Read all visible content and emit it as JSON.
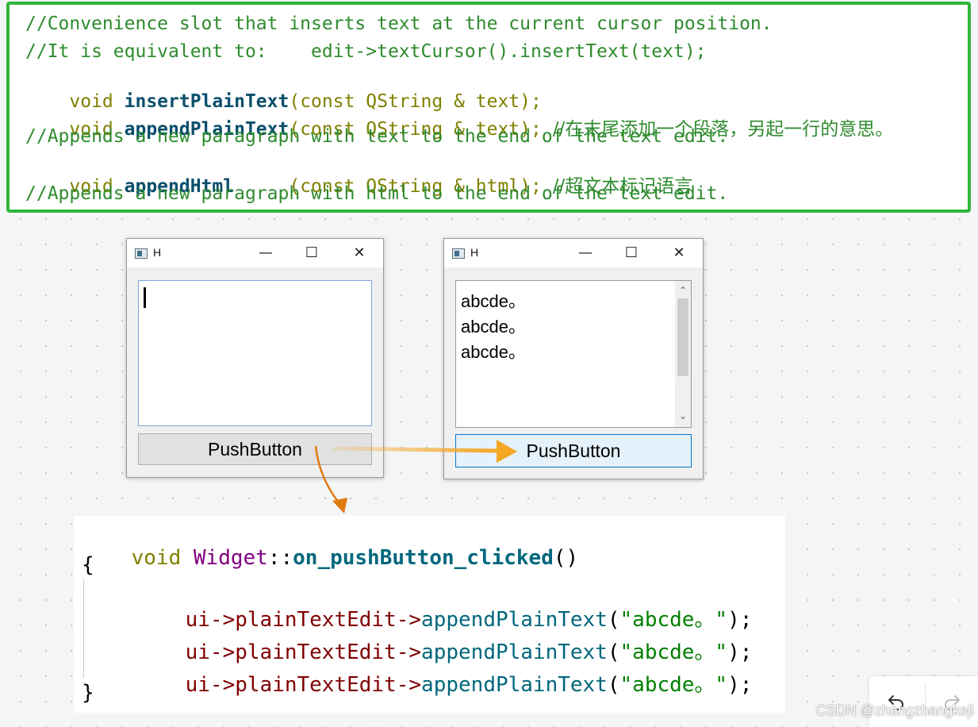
{
  "top_code": {
    "line1": "//Convenience slot that inserts text at the current cursor position.",
    "line2": "//It is equivalent to:    edit->textCursor().insertText(text);",
    "line3": {
      "kw": "void ",
      "fn": "insertPlainText",
      "rest": "(const QString & text);"
    },
    "line4": {
      "kw": "void ",
      "fn": "appendPlainText",
      "rest": "(const QString & text); ",
      "comment": "//在末尾添加一个段落，另起一行的意思。"
    },
    "line5": "//Appends a new paragraph with text to the end of the text edit.",
    "line6": {
      "kw": "void ",
      "fn": "appendHtml",
      "rest": "     (const QString & html); ",
      "comment": "//超文本标记语言"
    },
    "line7": "//Appends a new paragraph with html to the end of the text edit."
  },
  "window_left": {
    "title": "H",
    "minimize": "—",
    "maximize": "☐",
    "close": "✕",
    "button_label": "PushButton"
  },
  "window_right": {
    "title": "H",
    "minimize": "—",
    "maximize": "☐",
    "close": "✕",
    "text_lines": [
      "abcde。",
      "abcde。",
      "abcde。"
    ],
    "scroll_up": "⌃",
    "scroll_down": "⌄",
    "button_label": "PushButton"
  },
  "bottom_code": {
    "line1": {
      "kw": "void ",
      "cls": "Widget",
      "sep": "::",
      "fn": "on_pushButton_clicked",
      "rest": "()"
    },
    "open_brace": "{",
    "calls": [
      {
        "ptr": "ui->plainTextEdit->",
        "method": "appendPlainText",
        "p1": "(",
        "str": "\"abcde。\"",
        "p2": ");"
      },
      {
        "ptr": "ui->plainTextEdit->",
        "method": "appendPlainText",
        "p1": "(",
        "str": "\"abcde。\"",
        "p2": ");"
      },
      {
        "ptr": "ui->plainTextEdit->",
        "method": "appendPlainText",
        "p1": "(",
        "str": "\"abcde。\"",
        "p2": ");"
      }
    ],
    "close_brace": "}"
  },
  "toolbar": {
    "undo_icon": "undo-icon",
    "redo_icon": "redo-icon"
  },
  "watermark": "CSDN @zhangzhangkeji",
  "colors": {
    "box_border": "#2fb53a",
    "arrow": "#f5a623",
    "arrow_dark": "#e07b10",
    "comment": "#2e8b2e"
  }
}
